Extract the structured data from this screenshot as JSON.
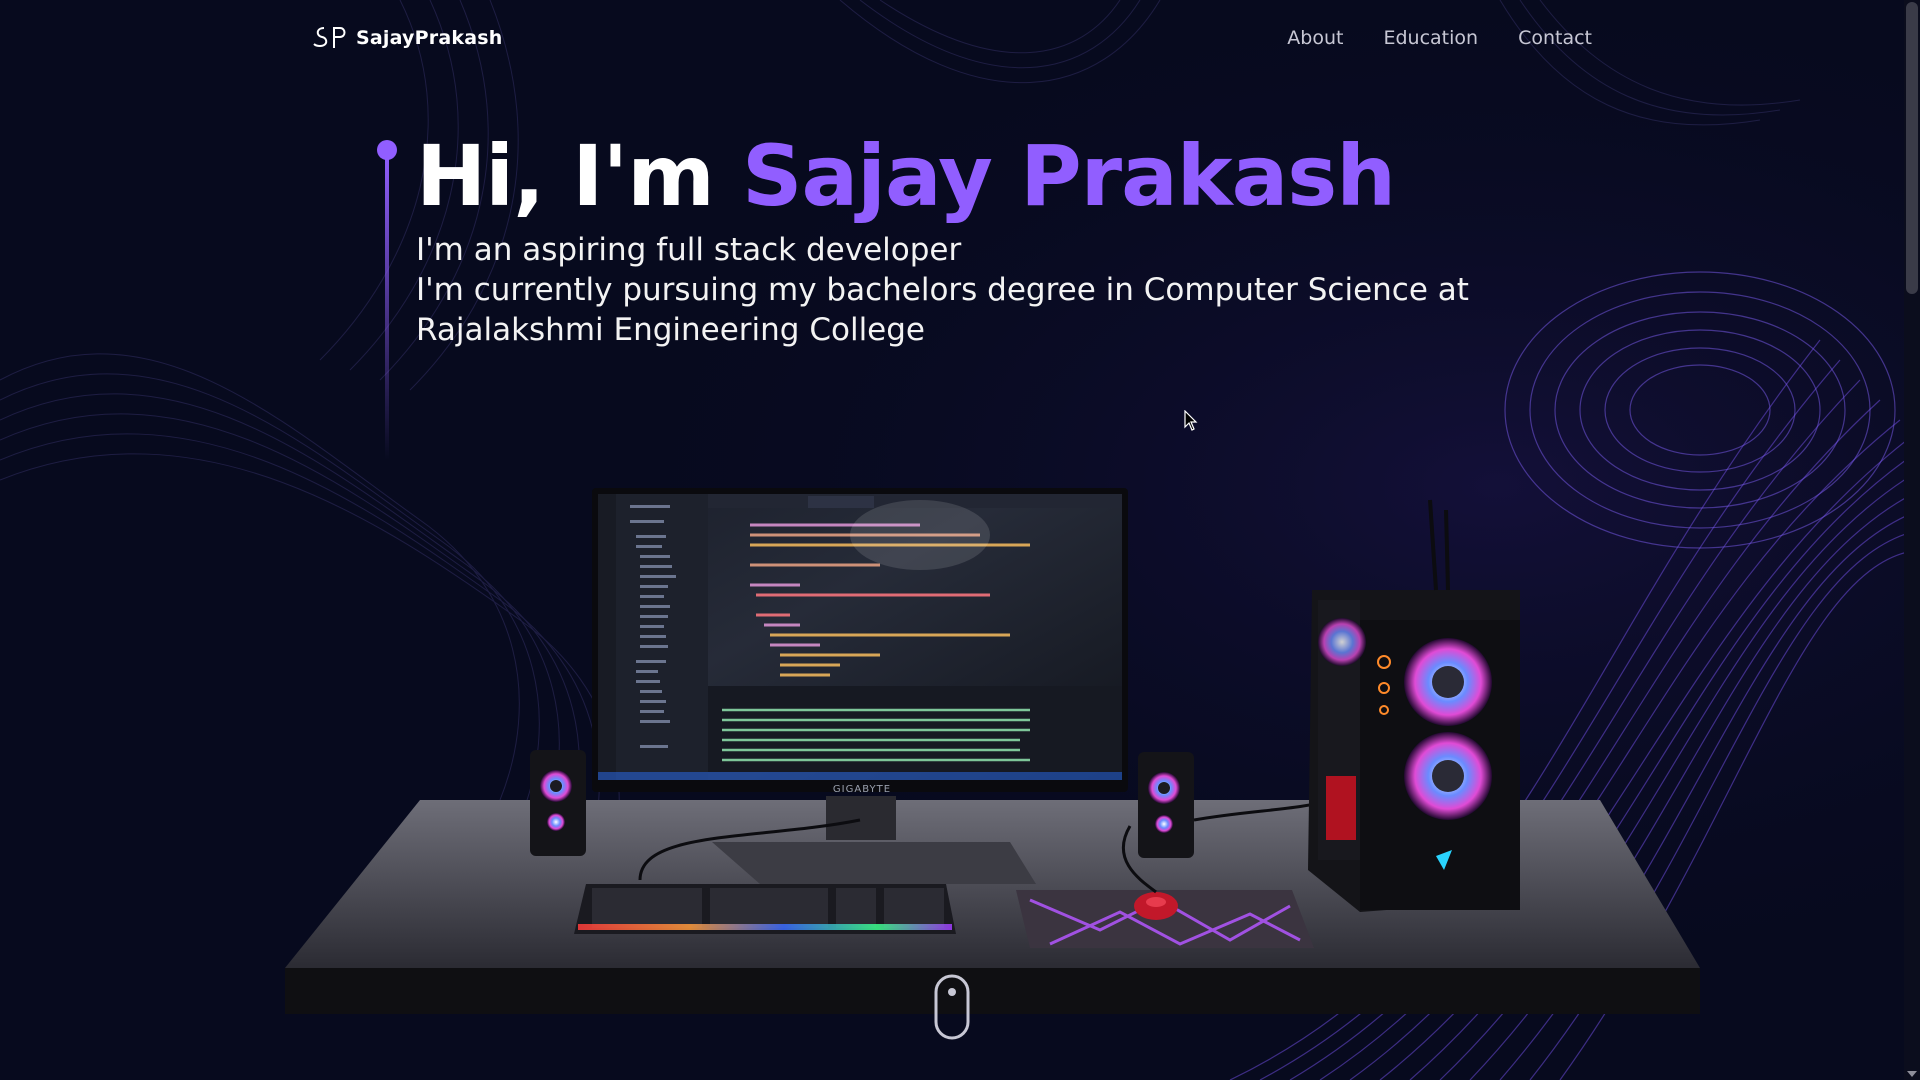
{
  "navbar": {
    "logo_text": "SajayPrakash",
    "logo_mark": "SP",
    "links": [
      {
        "label": "About"
      },
      {
        "label": "Education"
      },
      {
        "label": "Contact"
      }
    ]
  },
  "hero": {
    "greeting": "Hi, I'm ",
    "name": "Sajay Prakash",
    "line1": "I'm an aspiring full stack developer",
    "line2": "I'm currently pursuing my bachelors degree in Computer Science at Rajalakshmi Engineering College"
  },
  "scene": {
    "monitor_brand": "GIGABYTE"
  },
  "icons": {
    "scroll": "mouse-scroll-icon",
    "cursor": "mouse-pointer-icon"
  },
  "colors": {
    "background": "#070a1e",
    "accent": "#915eff",
    "text": "#ffffff",
    "nav_text": "#c7c7d4"
  }
}
